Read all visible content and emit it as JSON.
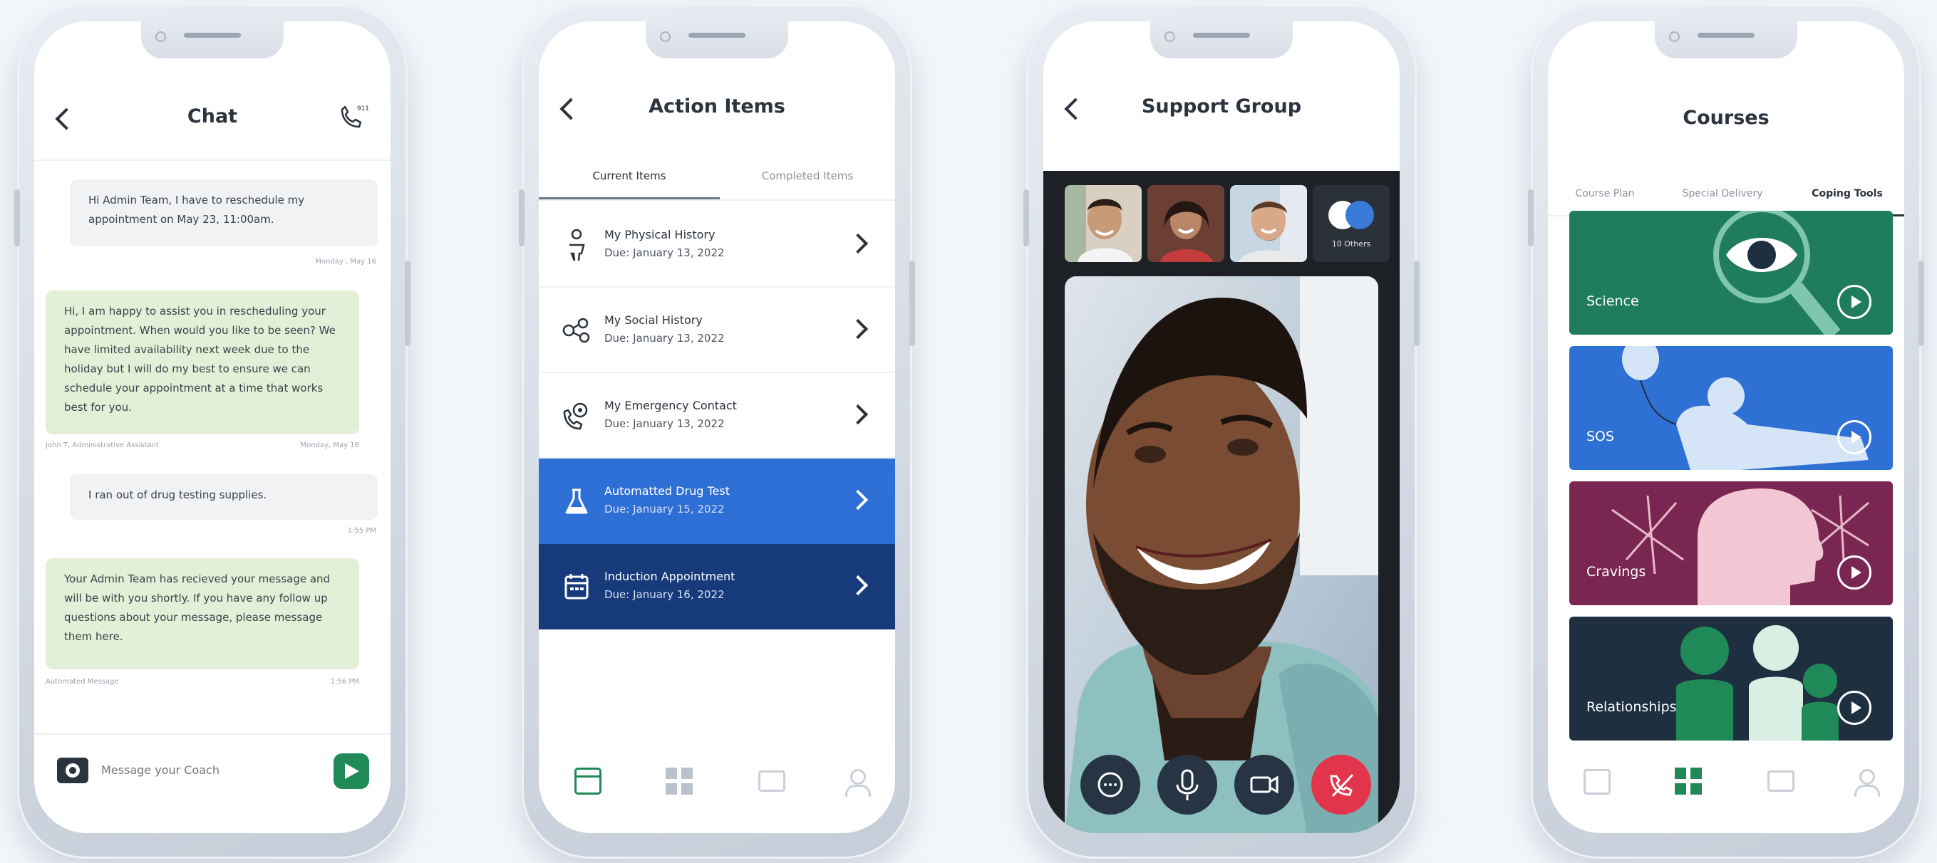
{
  "chat": {
    "title": "Chat",
    "messages": [
      {
        "text": "Hi Admin Team, I have to reschedule my appointment on May 23, 11:00am.",
        "meta_right": "Monday , May 16"
      },
      {
        "text": "Hi, I am happy to assist you in rescheduling your appointment. When would you like to be seen? We have limited availability next week due to the holiday but I will do my best to ensure we can schedule your appointment at a time that works best for you.",
        "meta_left": "John T, Administrative Assistant",
        "meta_right": "Monday, May 16"
      },
      {
        "text": "I ran out of drug testing supplies.",
        "meta_right": "1:55 PM"
      },
      {
        "text": "Your Admin Team has recieved your message and will be with you shortly. If you have any follow up questions about your message, please message them here.",
        "meta_left": "Automated Message",
        "meta_right": "1:56 PM"
      }
    ],
    "composer_placeholder": "Message your Coach",
    "call_icon_label": "911"
  },
  "action_items": {
    "title": "Action Items",
    "tabs": [
      "Current Items",
      "Completed Items"
    ],
    "items": [
      {
        "name": "My Physical History",
        "due": "Due: January 13, 2022",
        "icon": "person-icon"
      },
      {
        "name": "My Social History",
        "due": "Due: January 13, 2022",
        "icon": "social-icon"
      },
      {
        "name": "My Emergency Contact",
        "due": "Due: January 13, 2022",
        "icon": "contact-icon"
      },
      {
        "name": "Automatted Drug Test",
        "due": "Due: January 15, 2022",
        "icon": "flask-icon"
      },
      {
        "name": "Induction Appointment",
        "due": "Due: January 16, 2022",
        "icon": "calendar-icon"
      }
    ]
  },
  "support_group": {
    "title": "Support Group",
    "others_label": "10 Others"
  },
  "courses": {
    "title": "Courses",
    "tabs": [
      "Course Plan",
      "Special Delivery",
      "Coping Tools"
    ],
    "cards": [
      {
        "label": "Science",
        "color": "#1f7d5c"
      },
      {
        "label": "SOS",
        "color": "#2f70d4"
      },
      {
        "label": "Cravings",
        "color": "#7a2652"
      },
      {
        "label": "Relationships",
        "color": "#1e2f3f"
      }
    ]
  },
  "colors": {
    "accent_green": "#1f8a57",
    "accent_blue": "#2e6fd6",
    "navy": "#173a7a",
    "end_call": "#e2344a"
  }
}
